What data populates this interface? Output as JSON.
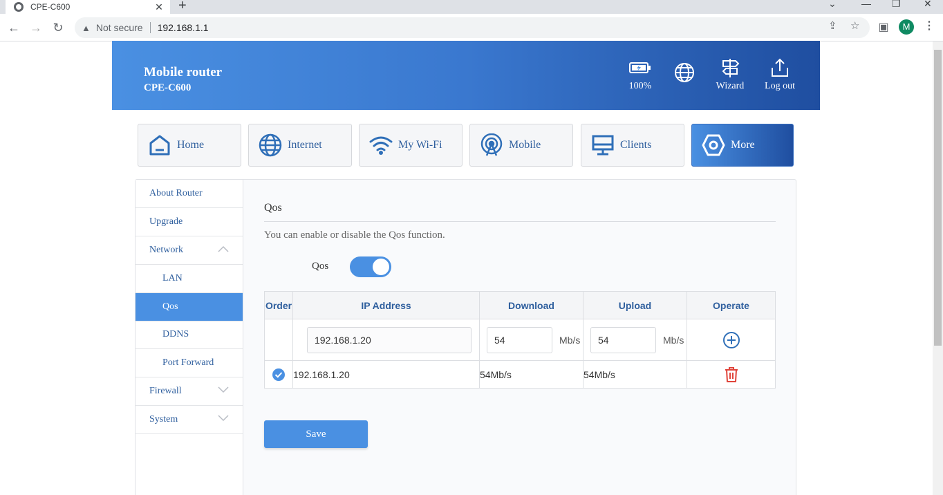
{
  "browser": {
    "tab_title": "CPE-C600",
    "tab_close": "✕",
    "new_tab": "+",
    "security_label": "Not secure",
    "url": "192.168.1.1",
    "profile_initial": "M"
  },
  "header": {
    "title": "Mobile router",
    "model": "CPE-C600",
    "battery_label": "100%",
    "wizard_label": "Wizard",
    "logout_label": "Log out"
  },
  "nav": {
    "home": "Home",
    "internet": "Internet",
    "wifi": "My Wi-Fi",
    "mobile": "Mobile",
    "clients": "Clients",
    "more": "More"
  },
  "sidebar": {
    "about": "About Router",
    "upgrade": "Upgrade",
    "network": "Network",
    "lan": "LAN",
    "qos": "Qos",
    "ddns": "DDNS",
    "port_forward": "Port Forward",
    "firewall": "Firewall",
    "system": "System"
  },
  "content": {
    "title": "Qos",
    "description": "You can enable or disable the Qos function.",
    "toggle_label": "Qos",
    "toggle_on": true
  },
  "table": {
    "headers": {
      "order": "Order",
      "ip": "IP Address",
      "download": "Download",
      "upload": "Upload",
      "operate": "Operate"
    },
    "input_row": {
      "ip_value": "192.168.1.20",
      "download_value": "54",
      "download_unit": "Mb/s",
      "upload_value": "54",
      "upload_unit": "Mb/s"
    },
    "rows": [
      {
        "ip": "192.168.1.20",
        "download": "54Mb/s",
        "upload": "54Mb/s",
        "checked": true
      }
    ]
  },
  "save_label": "Save",
  "colors": {
    "accent": "#4a90e2",
    "accent_dark": "#1f4ea0",
    "delete": "#e0443a"
  }
}
